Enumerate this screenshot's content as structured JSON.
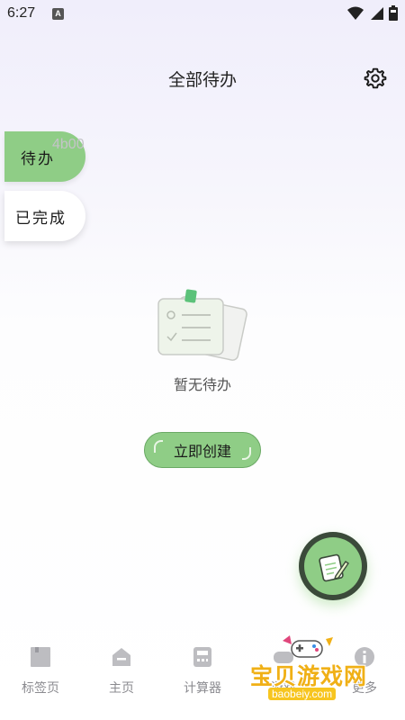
{
  "status_bar": {
    "time": "6:27",
    "notification_badge": "A"
  },
  "header": {
    "title": "全部待办"
  },
  "side_tabs": [
    {
      "label": "待办",
      "active": true
    },
    {
      "label": "已完成",
      "active": false
    }
  ],
  "debug_overlay": "4b00",
  "empty_state": {
    "message": "暂无待办"
  },
  "create_button": {
    "label": "立即创建"
  },
  "bottom_nav": [
    {
      "label": "标签页",
      "icon": "tag-page-icon"
    },
    {
      "label": "主页",
      "icon": "home-icon"
    },
    {
      "label": "计算器",
      "icon": "calculator-icon"
    },
    {
      "label": "游戏",
      "icon": "game-icon"
    },
    {
      "label": "更多",
      "icon": "more-icon"
    }
  ],
  "watermark": {
    "text": "宝贝游戏网",
    "url": "baobeiy.com"
  },
  "colors": {
    "accent": "#8fcd86",
    "accent_dark": "#3b4a3a",
    "nav_gray": "#8b8b90"
  }
}
